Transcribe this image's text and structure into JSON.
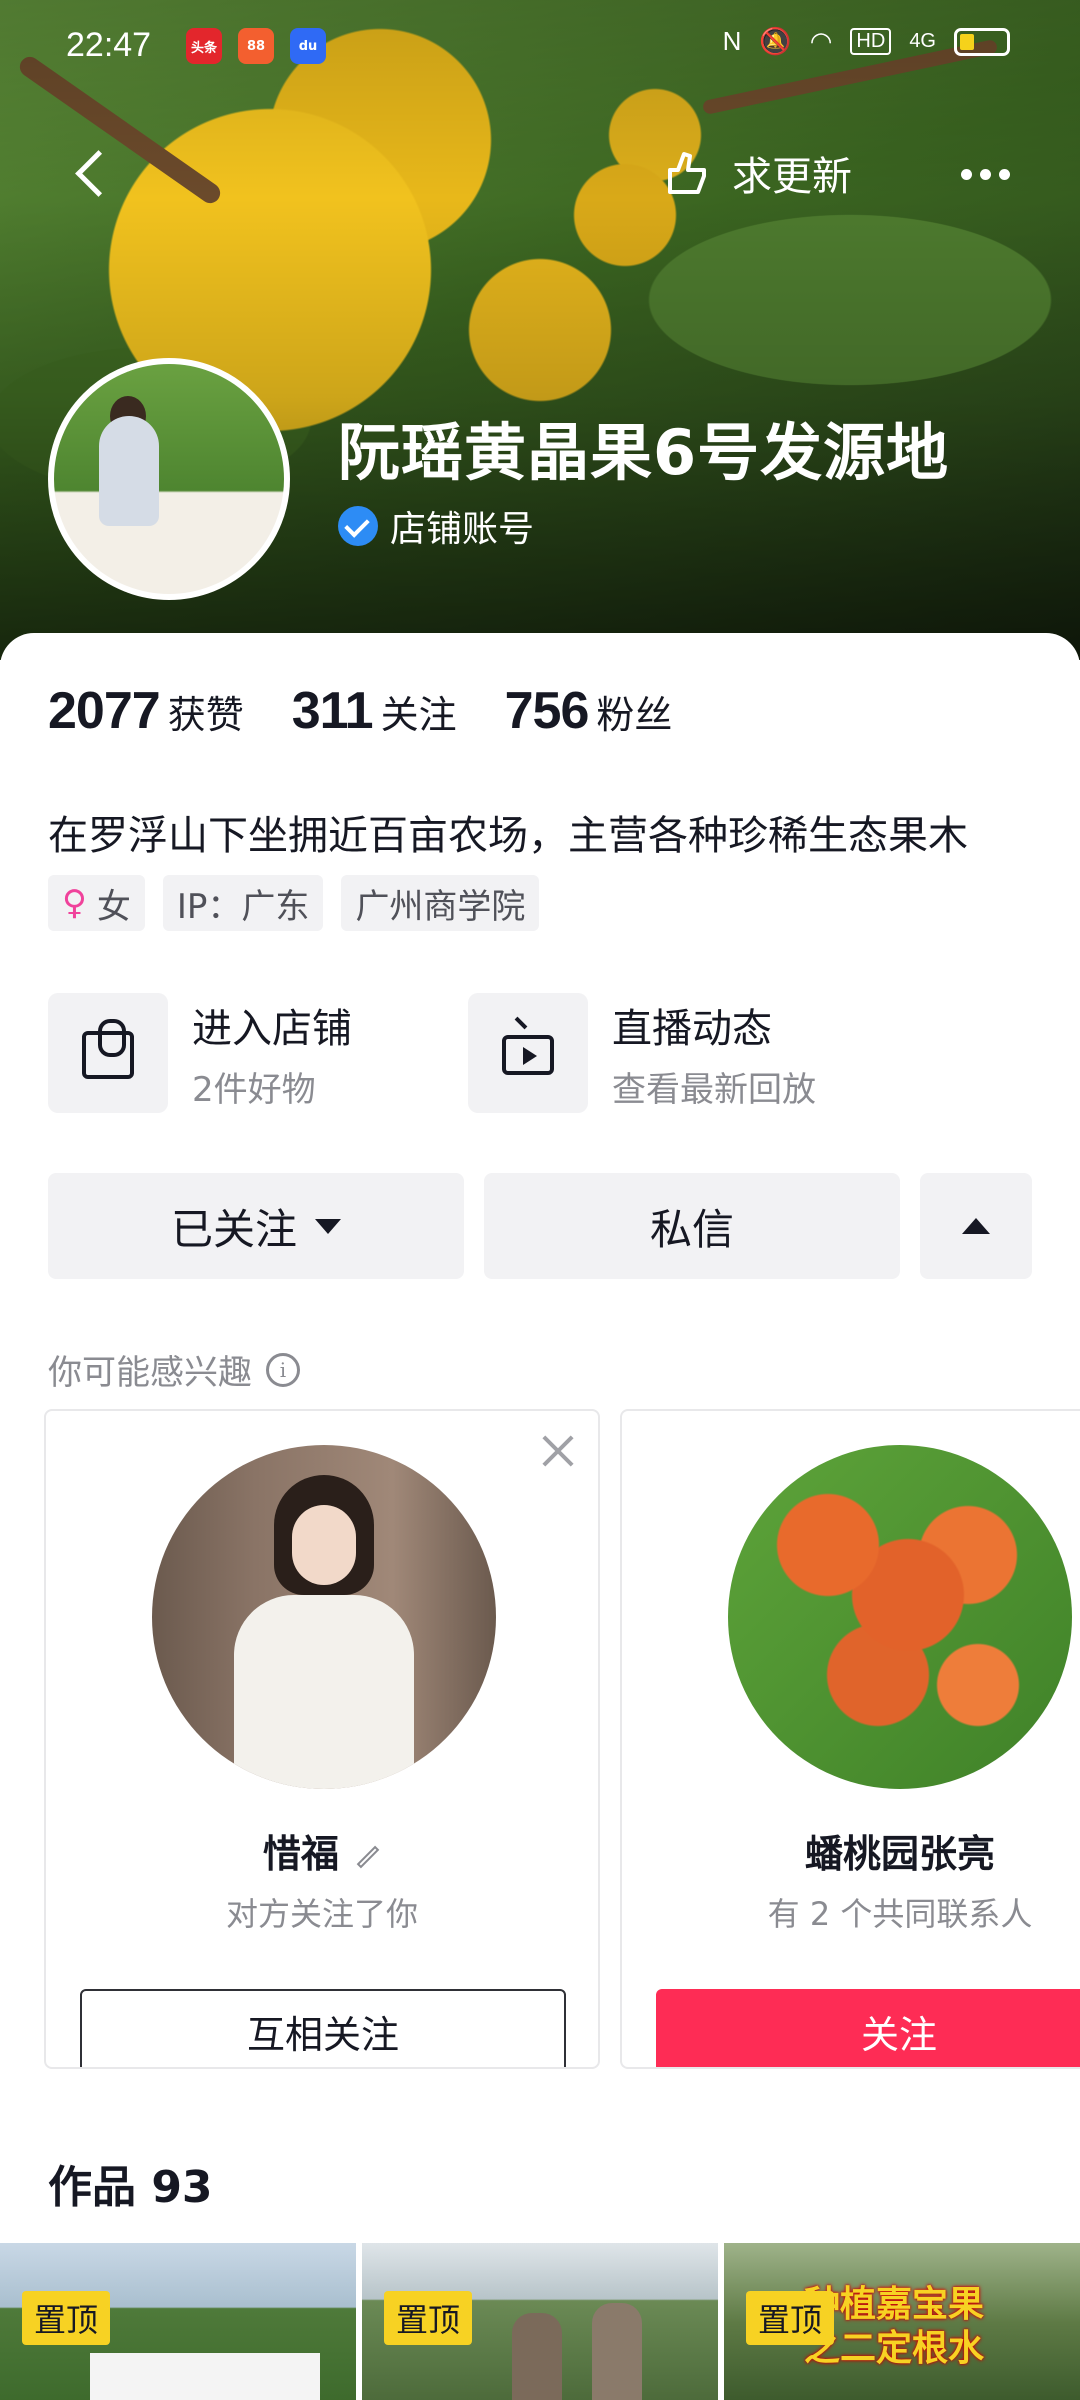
{
  "status_bar": {
    "time": "22:47",
    "apps": [
      "头条",
      "88",
      "du"
    ],
    "network": "4G",
    "hd": "HD"
  },
  "header": {
    "request_update_label": "求更新",
    "profile_name": "阮瑶黄晶果6号发源地",
    "account_type": "店铺账号"
  },
  "stats": {
    "likes_value": "2077",
    "likes_label": "获赞",
    "following_value": "311",
    "following_label": "关注",
    "followers_value": "756",
    "followers_label": "粉丝"
  },
  "bio": "在罗浮山下坐拥近百亩农场，主营各种珍稀生态果木",
  "tags": {
    "gender": "女",
    "ip": "IP：广东",
    "school": "广州商学院"
  },
  "entries": {
    "shop_title": "进入店铺",
    "shop_sub": "2件好物",
    "live_title": "直播动态",
    "live_sub": "查看最新回放"
  },
  "actions": {
    "followed_label": "已关注",
    "message_label": "私信"
  },
  "suggestions": {
    "title": "你可能感兴趣",
    "cards": [
      {
        "name": "惜福",
        "sub": "对方关注了你",
        "button": "互相关注"
      },
      {
        "name": "蟠桃园张亮",
        "sub": "有 2 个共同联系人",
        "button": "关注"
      }
    ]
  },
  "works": {
    "title": "作品 93",
    "pinned_label": "置顶",
    "third_overlay_line1": "种植嘉宝果",
    "third_overlay_line2": "之二定根水"
  },
  "colors": {
    "accent_red": "#fe2c55",
    "verify_blue": "#2d8cf5",
    "pin_yellow": "#f7d223"
  }
}
